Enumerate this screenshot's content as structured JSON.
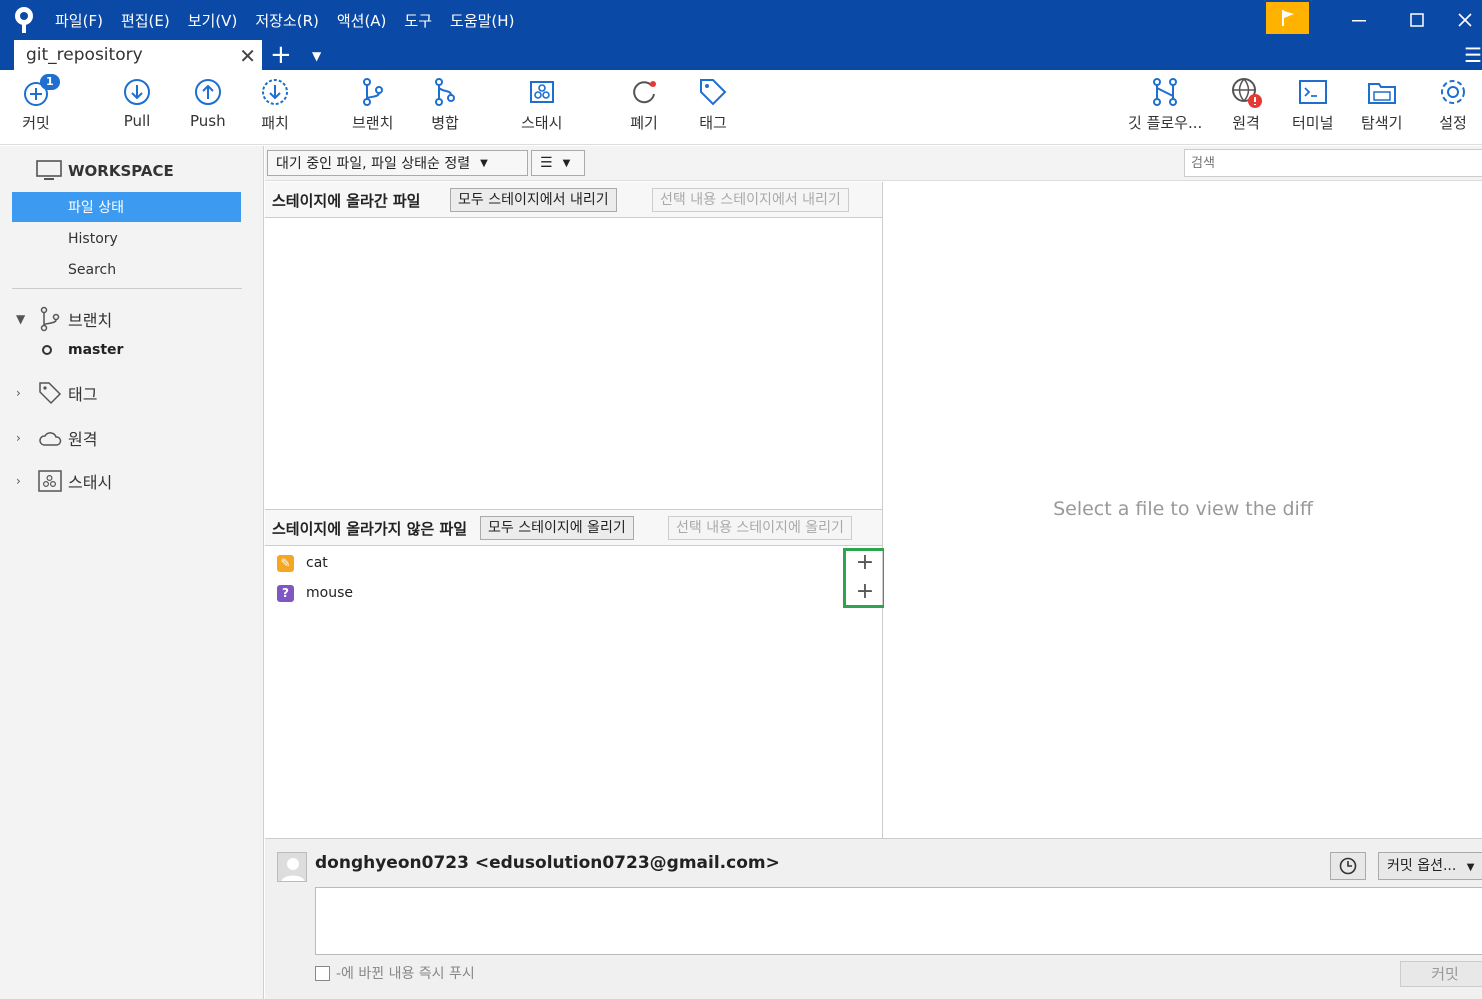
{
  "menu": [
    "파일(F)",
    "편집(E)",
    "보기(V)",
    "저장소(R)",
    "액션(A)",
    "도구",
    "도움말(H)"
  ],
  "tab": {
    "title": "git_repository"
  },
  "toolbar": {
    "commit": "커밋",
    "commit_badge": "1",
    "pull": "Pull",
    "push": "Push",
    "patch": "패치",
    "branch": "브랜치",
    "merge": "병합",
    "stash": "스태시",
    "discard": "폐기",
    "tag": "태그",
    "gitflow": "깃 플로우...",
    "remote": "원격",
    "terminal": "터미널",
    "explorer": "탐색기",
    "settings": "설정"
  },
  "sidebar": {
    "workspace": "WORKSPACE",
    "items": [
      "파일 상태",
      "History",
      "Search"
    ],
    "branch_group": "브랜치",
    "branch_current": "master",
    "tag_group": "태그",
    "remote_group": "원격",
    "stash_group": "스태시"
  },
  "filter": {
    "sort": "대기 중인 파일, 파일 상태순 정렬",
    "view": "☰",
    "search_placeholder": "검색"
  },
  "staged": {
    "title": "스테이지에 올라간 파일",
    "unstage_all": "모두 스테이지에서 내리기",
    "unstage_selected": "선택 내용 스테이지에서 내리기"
  },
  "unstaged": {
    "title": "스테이지에 올라가지 않은 파일",
    "stage_all": "모두 스테이지에 올리기",
    "stage_selected": "선택 내용 스테이지에 올리기",
    "files": [
      {
        "name": "cat",
        "status": "modified",
        "color": "#f5a623"
      },
      {
        "name": "mouse",
        "status": "untracked",
        "color": "#7e57c2"
      }
    ]
  },
  "diff": {
    "placeholder": "Select a file to view the diff"
  },
  "commit": {
    "author": "donghyeon0723 <edusolution0723@gmail.com>",
    "options": "커밋 옵션...",
    "push_label": "-에 바뀐 내용 즉시 푸시",
    "commit_button": "커밋"
  },
  "colors": {
    "titlebar": "#0b49a6",
    "accent": "#3c9af0",
    "highlight": "#2ea44f",
    "flag": "#ffb300"
  }
}
